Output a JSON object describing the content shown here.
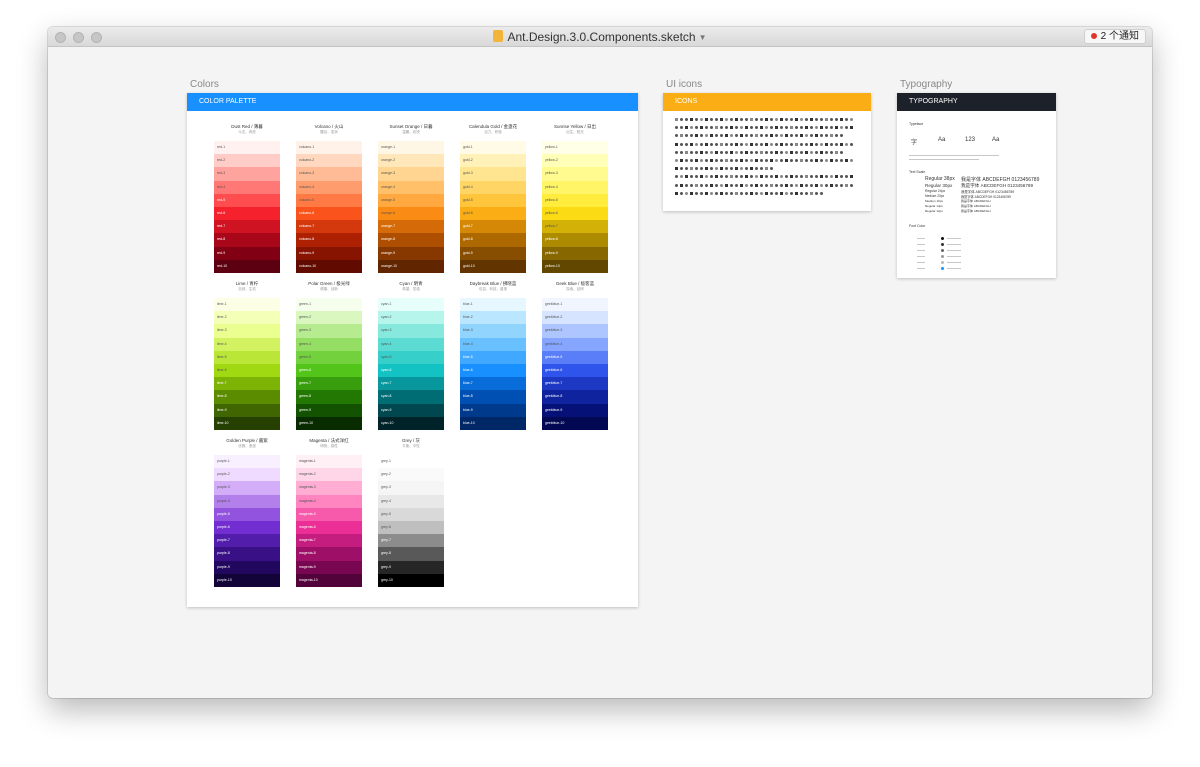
{
  "window": {
    "title": "Ant.Design.3.0.Components.sketch",
    "notification": "2 个通知"
  },
  "artboards": {
    "colors": {
      "label": "Colors",
      "header": "COLOR PALETTE",
      "header_color": "#1890ff",
      "palettes": [
        {
          "name": "Dust Red / 薄暮",
          "sub": "斗志、奔放",
          "key": "red",
          "colors": [
            "#fff1f0",
            "#ffccc7",
            "#ffa39e",
            "#ff7875",
            "#ff4d4f",
            "#f5222d",
            "#cf1322",
            "#a8071a",
            "#820014",
            "#5c0011"
          ]
        },
        {
          "name": "Volcano / 火山",
          "sub": "醒目、澎湃",
          "key": "volcano",
          "colors": [
            "#fff2e8",
            "#ffd8bf",
            "#ffbb96",
            "#ff9c6e",
            "#ff7a45",
            "#fa541c",
            "#d4380d",
            "#ad2102",
            "#871400",
            "#610b00"
          ]
        },
        {
          "name": "Sunset Orange / 日暮",
          "sub": "温暖、欢快",
          "key": "orange",
          "colors": [
            "#fff7e6",
            "#ffe7ba",
            "#ffd591",
            "#ffc069",
            "#ffa940",
            "#fa8c16",
            "#d46b08",
            "#ad4e00",
            "#873800",
            "#612500"
          ]
        },
        {
          "name": "Calendula Gold / 金盏花",
          "sub": "活力、积极",
          "key": "gold",
          "colors": [
            "#fffbe6",
            "#fff1b8",
            "#ffe58f",
            "#ffd666",
            "#ffc53d",
            "#faad14",
            "#d48806",
            "#ad6800",
            "#874d00",
            "#613400"
          ]
        },
        {
          "name": "Sunrise Yellow / 日出",
          "sub": "出生、阳光",
          "key": "yellow",
          "colors": [
            "#feffe6",
            "#ffffb8",
            "#fffb8f",
            "#fff566",
            "#ffec3d",
            "#fadb14",
            "#d4b106",
            "#ad8b00",
            "#876800",
            "#614700"
          ]
        },
        {
          "name": "Lime / 青柠",
          "sub": "自然、生机",
          "key": "lime",
          "colors": [
            "#fcffe6",
            "#f4ffb8",
            "#eaff8f",
            "#d3f261",
            "#bae637",
            "#a0d911",
            "#7cb305",
            "#5b8c00",
            "#3f6600",
            "#254000"
          ]
        },
        {
          "name": "Polar Green / 极光绿",
          "sub": "健康、创新",
          "key": "green",
          "colors": [
            "#f6ffed",
            "#d9f7be",
            "#b7eb8f",
            "#95de64",
            "#73d13d",
            "#52c41a",
            "#389e0d",
            "#237804",
            "#135200",
            "#092b00"
          ]
        },
        {
          "name": "Cyan / 明青",
          "sub": "希望、坚强",
          "key": "cyan",
          "colors": [
            "#e6fffb",
            "#b5f5ec",
            "#87e8de",
            "#5cdbd3",
            "#36cfc9",
            "#13c2c2",
            "#08979c",
            "#006d75",
            "#00474f",
            "#002329"
          ]
        },
        {
          "name": "Daybreak Blue / 拂晓蓝",
          "sub": "包容、科技、普惠",
          "key": "blue",
          "colors": [
            "#e6f7ff",
            "#bae7ff",
            "#91d5ff",
            "#69c0ff",
            "#40a9ff",
            "#1890ff",
            "#096dd9",
            "#0050b3",
            "#003a8c",
            "#002766"
          ]
        },
        {
          "name": "Geek Blue / 极客蓝",
          "sub": "探索、钻研",
          "key": "geekblue",
          "colors": [
            "#f0f5ff",
            "#d6e4ff",
            "#adc6ff",
            "#85a5ff",
            "#597ef7",
            "#2f54eb",
            "#1d39c4",
            "#10239e",
            "#061178",
            "#030852"
          ]
        },
        {
          "name": "Golden Purple / 酱紫",
          "sub": "优雅、浪漫",
          "key": "purple",
          "colors": [
            "#f9f0ff",
            "#efdbff",
            "#d3adf7",
            "#b37feb",
            "#9254de",
            "#722ed1",
            "#531dab",
            "#391085",
            "#22075e",
            "#120338"
          ]
        },
        {
          "name": "Magenta / 法式洋红",
          "sub": "明快、感性",
          "key": "magenta",
          "colors": [
            "#fff0f6",
            "#ffd6e7",
            "#ffadd2",
            "#ff85c0",
            "#f759ab",
            "#eb2f96",
            "#c41d7f",
            "#9e1068",
            "#780650",
            "#520339"
          ]
        },
        {
          "name": "Grey / 灰",
          "sub": "平衡、中性",
          "key": "grey",
          "colors": [
            "#ffffff",
            "#fafafa",
            "#f5f5f5",
            "#e8e8e8",
            "#d9d9d9",
            "#bfbfbf",
            "#8c8c8c",
            "#595959",
            "#262626",
            "#000000"
          ]
        }
      ]
    },
    "icons": {
      "label": "UI icons",
      "header": "ICONS",
      "header_color": "#faad14"
    },
    "typography": {
      "label": "Typography",
      "header": "TYPOGRAPHY",
      "header_color": "#1d2129",
      "typefaces_label": "Typeface",
      "typefaces": [
        "字",
        "Aa",
        "123",
        "Aa"
      ],
      "text_scale_label": "Text Scale",
      "scale": [
        {
          "name": "Regular 38px",
          "sample": "我是字体 ABCDEFGH 0123456789"
        },
        {
          "name": "Regular 30px",
          "sample": "我是字体 ABCDEFGH 0123456789"
        },
        {
          "name": "Regular 24px",
          "sample": "我是字体 ABCDEFGH 0123456789"
        },
        {
          "name": "Medium 20px",
          "sample": "我是字体 ABCDEFGH 0123456789"
        },
        {
          "name": "Medium 16px",
          "sample": "我是字体 ABCDEFGH"
        },
        {
          "name": "Regular 14px",
          "sample": "我是字体 ABCDEFGH"
        },
        {
          "name": "Regular 12px",
          "sample": "我是字体 ABCDEFGH"
        }
      ],
      "font_color_label": "Font Color"
    }
  }
}
